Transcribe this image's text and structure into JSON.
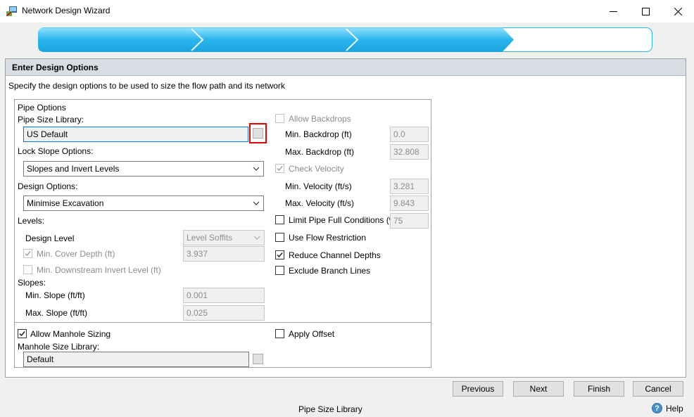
{
  "window": {
    "title": "Network Design Wizard"
  },
  "panel": {
    "header": "Enter Design Options",
    "description": "Specify the design options to be used to size the flow path and its network"
  },
  "pipe_options": {
    "group_label": "Pipe Options",
    "pipe_size_library_label": "Pipe Size Library:",
    "pipe_size_library_value": "US Default",
    "lock_slope_label": "Lock Slope Options:",
    "lock_slope_value": "Slopes and Invert Levels",
    "design_options_label": "Design Options:",
    "design_options_value": "Minimise Excavation",
    "levels_label": "Levels:",
    "design_level_label": "Design Level",
    "design_level_value": "Level Soffits",
    "min_cover_label": "Min. Cover Depth (ft)",
    "min_cover_value": "3.937",
    "min_downstream_label": "Min. Downstream Invert Level (ft)",
    "slopes_label": "Slopes:",
    "min_slope_label": "Min. Slope (ft/ft)",
    "min_slope_value": "0.001",
    "max_slope_label": "Max. Slope (ft/ft)",
    "max_slope_value": "0.025"
  },
  "right_options": {
    "allow_backdrops": "Allow Backdrops",
    "min_backdrop_label": "Min. Backdrop (ft)",
    "min_backdrop_value": "0.0",
    "max_backdrop_label": "Max. Backdrop (ft)",
    "max_backdrop_value": "32.808",
    "check_velocity": "Check Velocity",
    "min_velocity_label": "Min. Velocity (ft/s)",
    "min_velocity_value": "3.281",
    "max_velocity_label": "Max. Velocity (ft/s)",
    "max_velocity_value": "9.843",
    "limit_pipe_full": "Limit Pipe Full Conditions (%)",
    "limit_pipe_full_value": "75",
    "use_flow_restriction": "Use Flow Restriction",
    "reduce_channel_depths": "Reduce Channel Depths",
    "exclude_branch_lines": "Exclude Branch Lines"
  },
  "manhole": {
    "allow_manhole_sizing": "Allow Manhole Sizing",
    "library_label": "Manhole Size Library:",
    "library_value": "Default",
    "apply_offset": "Apply Offset"
  },
  "buttons": {
    "previous": "Previous",
    "next": "Next",
    "finish": "Finish",
    "cancel": "Cancel"
  },
  "status": {
    "text": "Pipe Size Library",
    "help": "Help"
  },
  "checks": {
    "allow_backdrops": false,
    "check_velocity": true,
    "limit_pipe_full": false,
    "use_flow_restriction": false,
    "reduce_channel_depths": true,
    "exclude_branch_lines": false,
    "min_cover": true,
    "min_downstream": false,
    "allow_manhole_sizing": true,
    "apply_offset": false
  },
  "progress": {
    "steps_total": 4,
    "steps_completed": 3
  },
  "colors": {
    "progress_fill": "#29b6ee",
    "highlight": "#e00000",
    "panel_header": "#d7dde3"
  },
  "icons": {
    "app": "network-wizard-icon",
    "minimize": "minimize-icon",
    "maximize": "maximize-icon",
    "close": "close-icon",
    "dropdown": "chevron-down-icon",
    "check": "checkmark-icon",
    "help": "help-icon"
  }
}
